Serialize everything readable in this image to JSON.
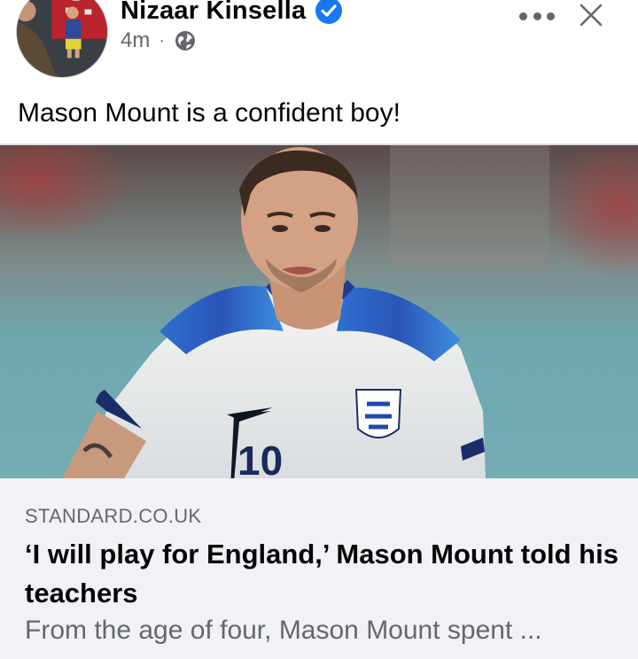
{
  "post": {
    "author": "Nizaar Kinsella",
    "verified_icon": "verified-badge-icon",
    "time": "4m",
    "separator": "·",
    "audience_icon": "globe-icon",
    "text": "Mason Mount is a confident boy!"
  },
  "header_actions": {
    "more_icon": "more-dots-icon",
    "close_icon": "close-icon"
  },
  "link_card": {
    "source": "STANDARD.CO.UK",
    "title": "‘I will play for England,’ Mason Mount told his teachers",
    "description": "From the age of four, Mason Mount spent ..."
  },
  "colors": {
    "accent": "#1877f2",
    "secondary_text": "#65676b",
    "card_background": "#f0f2f5"
  }
}
